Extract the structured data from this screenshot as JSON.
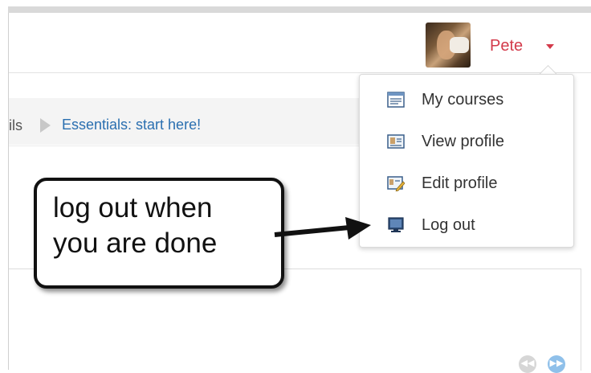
{
  "header": {
    "user_name": "Pete"
  },
  "breadcrumb": {
    "previous_fragment": "ils",
    "current": "Essentials: start here!"
  },
  "user_menu": {
    "items": [
      {
        "label": "My courses",
        "icon": "courses-icon"
      },
      {
        "label": "View profile",
        "icon": "profile-card-icon"
      },
      {
        "label": "Edit profile",
        "icon": "edit-profile-icon"
      },
      {
        "label": "Log out",
        "icon": "monitor-logout-icon"
      }
    ]
  },
  "callout": {
    "line1": "log out when",
    "line2": "you are done"
  },
  "pager": {
    "prev_icon": "rewind-icon",
    "next_icon": "fast-forward-icon"
  },
  "colors": {
    "username": "#d33a4a",
    "link": "#2a6fb0",
    "pager_next": "#8fc0ea"
  }
}
